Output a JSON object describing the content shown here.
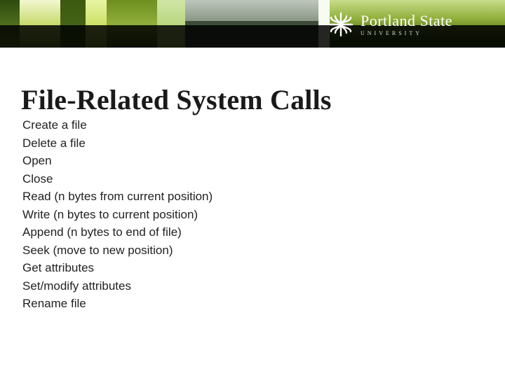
{
  "header": {
    "university_main": "Portland State",
    "university_sub": "UNIVERSITY"
  },
  "slide": {
    "title": "File-Related System Calls",
    "items": [
      "Create a file",
      "Delete a file",
      "Open",
      "Close",
      "Read (n bytes from current position)",
      "Write (n bytes to current position)",
      "Append (n bytes to end of file)",
      "Seek (move to new position)",
      "Get attributes",
      "Set/modify attributes",
      "Rename file"
    ]
  }
}
